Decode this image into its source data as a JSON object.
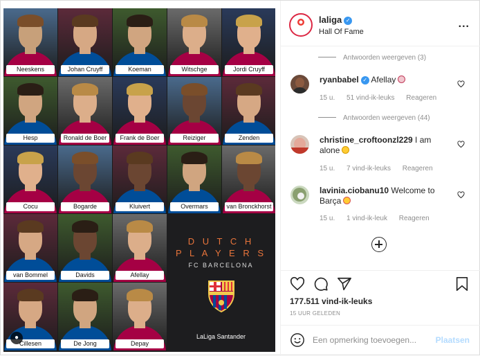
{
  "post": {
    "players": [
      {
        "name": "Neeskens"
      },
      {
        "name": "Johan Cruyff"
      },
      {
        "name": "Koeman"
      },
      {
        "name": "Witschge"
      },
      {
        "name": "Jordi Cruyff"
      },
      {
        "name": "Hesp"
      },
      {
        "name": "Ronald de Boer"
      },
      {
        "name": "Frank de Boer"
      },
      {
        "name": "Reiziger"
      },
      {
        "name": "Zenden"
      },
      {
        "name": "Cocu"
      },
      {
        "name": "Bogarde"
      },
      {
        "name": "Kluivert"
      },
      {
        "name": "Overmars"
      },
      {
        "name": "van Bronckhorst"
      },
      {
        "name": "van Bommel"
      },
      {
        "name": "Davids"
      },
      {
        "name": "Afellay"
      },
      {
        "name": "Cillesen"
      },
      {
        "name": "De Jong"
      },
      {
        "name": "Depay"
      }
    ],
    "promo": {
      "line1": "D U T C H",
      "line2": "P L A Y E R S",
      "line3": "FC BARCELONA",
      "sponsor": "LaLiga Santander"
    },
    "user_tag_icon": "person-icon"
  },
  "header": {
    "account": "laliga",
    "subtitle": "Hall Of Fame",
    "more": "..."
  },
  "thread": {
    "replies_1": "Antwoorden weergeven (3)",
    "replies_2": "Antwoorden weergeven (44)",
    "comments": [
      {
        "user": "ryanbabel",
        "text": "Afellay",
        "time": "15 u.",
        "likes": "51 vind-ik-leuks",
        "reply": "Reageren"
      },
      {
        "user": "christine_croftoonzl229",
        "text": "I am alone",
        "time": "15 u.",
        "likes": "7 vind-ik-leuks",
        "reply": "Reageren"
      },
      {
        "user": "lavinia.ciobanu10",
        "text": "Welcome to Barça",
        "time": "15 u.",
        "likes": "1 vind-ik-leuk",
        "reply": "Reageren"
      }
    ]
  },
  "actions": {
    "likes": "177.511 vind-ik-leuks",
    "posted": "15 UUR GELEDEN"
  },
  "composer": {
    "placeholder": "Een opmerking toevoegen...",
    "post_label": "Plaatsen"
  },
  "colors": {
    "accent": "#3897f0",
    "promo_orange": "#e8743b",
    "post_disabled": "#b3dbff"
  }
}
